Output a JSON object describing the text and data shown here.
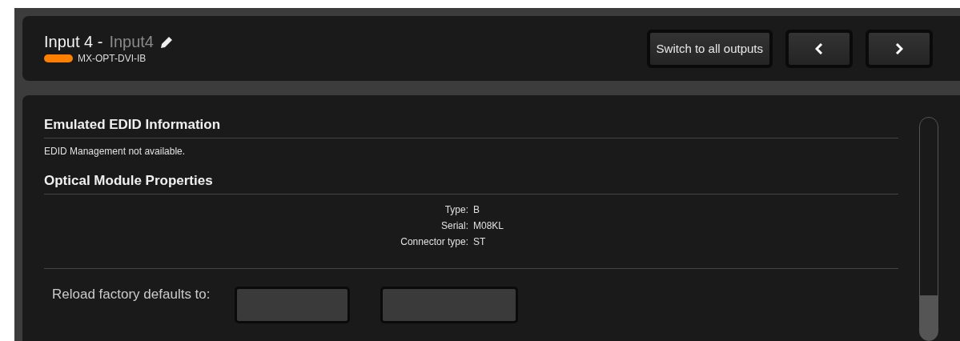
{
  "header": {
    "title": "Input 4 -",
    "name": "Input4",
    "device": {
      "label": "MX-OPT-DVI-IB",
      "color": "#ff8000"
    },
    "buttons": [
      "Switch to all outputs"
    ]
  },
  "sections": [
    {
      "title": "Emulated EDID Information",
      "text": "EDID Management not available."
    },
    {
      "title": "Optical Module Properties",
      "properties": [
        {
          "label": "Type:",
          "value": "B"
        },
        {
          "label": "Serial:",
          "value": "M08KL"
        },
        {
          "label": "Connector type:",
          "value": "ST"
        }
      ]
    }
  ],
  "reload": {
    "label": "Reload factory defaults to:"
  }
}
